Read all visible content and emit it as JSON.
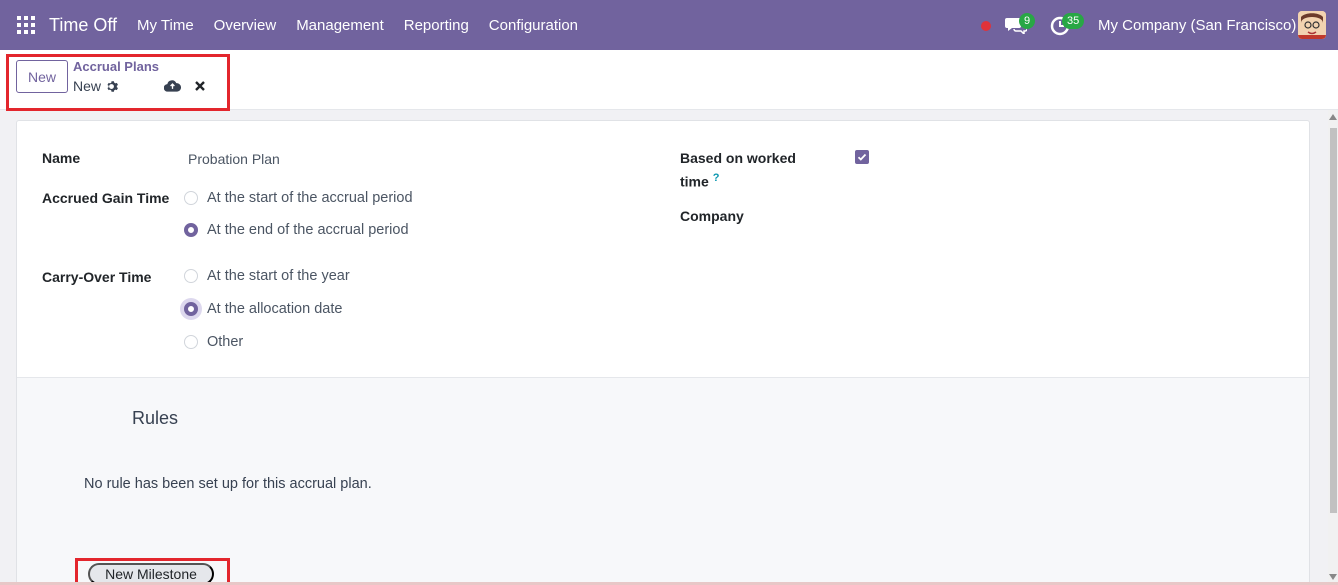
{
  "navbar": {
    "app_title": "Time Off",
    "menu": [
      "My Time",
      "Overview",
      "Management",
      "Reporting",
      "Configuration"
    ],
    "messages_count": "9",
    "activities_count": "35",
    "company": "My Company (San Francisco)"
  },
  "control_panel": {
    "new_label": "New",
    "breadcrumb_parent": "Accrual Plans",
    "breadcrumb_current": "New"
  },
  "form": {
    "name_label": "Name",
    "name_value": "Probation Plan",
    "accrued_gain_label": "Accrued Gain Time",
    "accrued_gain_options": [
      "At the start of the accrual period",
      "At the end of the accrual period"
    ],
    "accrued_gain_selected": "At the end of the accrual period",
    "carry_over_label": "Carry-Over Time",
    "carry_over_options": [
      "At the start of the year",
      "At the allocation date",
      "Other"
    ],
    "carry_over_selected": "At the allocation date",
    "based_on_worked_label_1": "Based on worked",
    "based_on_worked_label_2": "time",
    "based_on_worked_help": "?",
    "based_on_worked_checked": true,
    "company_label": "Company"
  },
  "rules": {
    "title": "Rules",
    "empty_message": "No rule has been set up for this accrual plan.",
    "new_milestone_label": "New Milestone"
  },
  "colors": {
    "brand": "#71639e",
    "badge_green": "#28a745",
    "highlight_red": "#e3262d"
  }
}
